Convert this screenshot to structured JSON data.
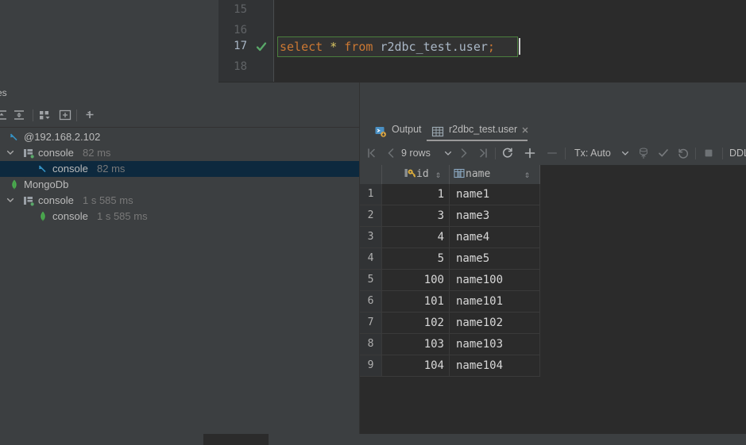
{
  "editor": {
    "lines": [
      {
        "num": "15",
        "text": "",
        "has_check": false
      },
      {
        "num": "16",
        "text": "",
        "has_check": false
      },
      {
        "num": "17",
        "text": "select * from r2dbc_test.user;",
        "has_check": true
      },
      {
        "num": "18",
        "text": "",
        "has_check": false
      }
    ],
    "statement": {
      "kw_select": "select",
      "star": "*",
      "kw_from": "from",
      "table": "r2dbc_test.user",
      "semicolon": ";"
    },
    "colors": {
      "keyword": "#cc7832",
      "star": "#d9c562",
      "identifier": "#a9b7c6",
      "statement_border": "#4b7f3e",
      "background": "#2b2b2b"
    }
  },
  "services": {
    "title": "es",
    "toolbar": [
      {
        "name": "expand-all-icon",
        "label": "Expand All"
      },
      {
        "name": "collapse-all-icon",
        "label": "Collapse All"
      },
      {
        "name": "group-by-icon",
        "label": "Group By"
      },
      {
        "name": "add-frame-icon",
        "label": "Open in New Window"
      },
      {
        "name": "add-icon",
        "label": "Add"
      }
    ],
    "tree": [
      {
        "label": "@192.168.2.102",
        "time": "",
        "icon": "query-console-icon",
        "indent": 10,
        "twisty": "",
        "selected": false
      },
      {
        "label": "console",
        "time": "82 ms",
        "icon": "console-session-icon",
        "indent": 28,
        "twisty": "expanded",
        "selected": false
      },
      {
        "label": "console",
        "time": "82 ms",
        "icon": "query-console-icon",
        "indent": 46,
        "twisty": "",
        "selected": true
      },
      {
        "label": "MongoDb",
        "time": "",
        "icon": "mongodb-leaf-icon",
        "indent": 10,
        "twisty": "",
        "selected": false
      },
      {
        "label": "console",
        "time": "1 s 585 ms",
        "icon": "console-session-icon",
        "indent": 28,
        "twisty": "expanded",
        "selected": false
      },
      {
        "label": "console",
        "time": "1 s 585 ms",
        "icon": "mongodb-leaf-icon",
        "indent": 46,
        "twisty": "",
        "selected": false
      }
    ]
  },
  "results": {
    "tabs": [
      {
        "label": "Output",
        "icon": "output-icon",
        "active": false,
        "closable": false
      },
      {
        "label": "r2dbc_test.user",
        "icon": "table-icon",
        "active": true,
        "closable": true
      }
    ],
    "toolbar": {
      "first_page": "first-page-icon",
      "prev_page": "prev-page-icon",
      "rows_label": "9 rows",
      "next_page": "next-page-icon",
      "last_page": "last-page-icon",
      "reload": "reload-icon",
      "add_row": "add-row-icon",
      "delete_row": "delete-row-icon",
      "tx_label": "Tx: Auto",
      "submit": "db-submit-icon",
      "commit": "commit-icon",
      "rollback": "rollback-icon",
      "stop": "stop-icon",
      "ddl_label": "DDL"
    },
    "grid": {
      "columns": [
        {
          "label": "id",
          "icon": "primary-key-icon",
          "sortable": true
        },
        {
          "label": "name",
          "icon": "column-icon",
          "sortable": true
        }
      ],
      "rows": [
        {
          "n": "1",
          "id": "1",
          "name": "name1"
        },
        {
          "n": "2",
          "id": "3",
          "name": "name3"
        },
        {
          "n": "3",
          "id": "4",
          "name": "name4"
        },
        {
          "n": "4",
          "id": "5",
          "name": "name5"
        },
        {
          "n": "5",
          "id": "100",
          "name": "name100"
        },
        {
          "n": "6",
          "id": "101",
          "name": "name101"
        },
        {
          "n": "7",
          "id": "102",
          "name": "name102"
        },
        {
          "n": "8",
          "id": "103",
          "name": "name103"
        },
        {
          "n": "9",
          "id": "104",
          "name": "name104"
        }
      ]
    }
  }
}
